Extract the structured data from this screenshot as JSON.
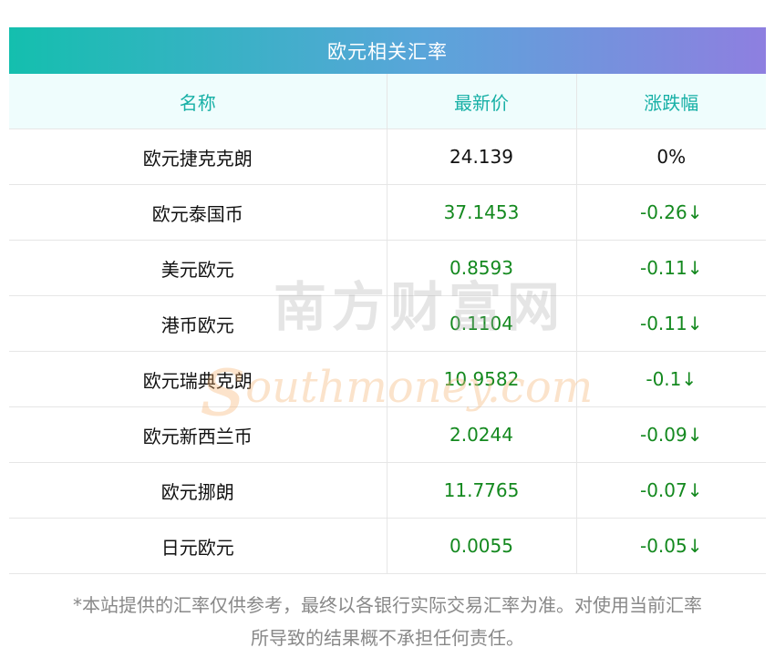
{
  "title": "欧元相关汇率",
  "columns": [
    "名称",
    "最新价",
    "涨跌幅"
  ],
  "rows": [
    {
      "name": "欧元捷克克朗",
      "price": "24.139",
      "change": "0%"
    },
    {
      "name": "欧元泰国币",
      "price": "37.1453",
      "change": "-0.26↓"
    },
    {
      "name": "美元欧元",
      "price": "0.8593",
      "change": "-0.11↓"
    },
    {
      "name": "港币欧元",
      "price": "0.1104",
      "change": "-0.11↓"
    },
    {
      "name": "欧元瑞典克朗",
      "price": "10.9582",
      "change": "-0.1↓"
    },
    {
      "name": "欧元新西兰币",
      "price": "2.0244",
      "change": "-0.09↓"
    },
    {
      "name": "欧元挪朗",
      "price": "11.7765",
      "change": "-0.07↓"
    },
    {
      "name": "日元欧元",
      "price": "0.0055",
      "change": "-0.05↓"
    }
  ],
  "note": {
    "line1": "*本站提供的汇率仅供参考，最终以各银行实际交易汇率为准。对使用当前汇率",
    "line2": "所导致的结果概不承担任何责任。"
  },
  "watermark": {
    "cn": "南方财富网",
    "en_first": "s",
    "en_rest": "outhmoney.com"
  },
  "colors": {
    "header_gradient_start": "#14bfae",
    "header_gradient_end": "#8e7fe0",
    "column_header_text": "#17b0a6",
    "column_header_bg": "#effdfd",
    "change_down": "#14891f"
  }
}
